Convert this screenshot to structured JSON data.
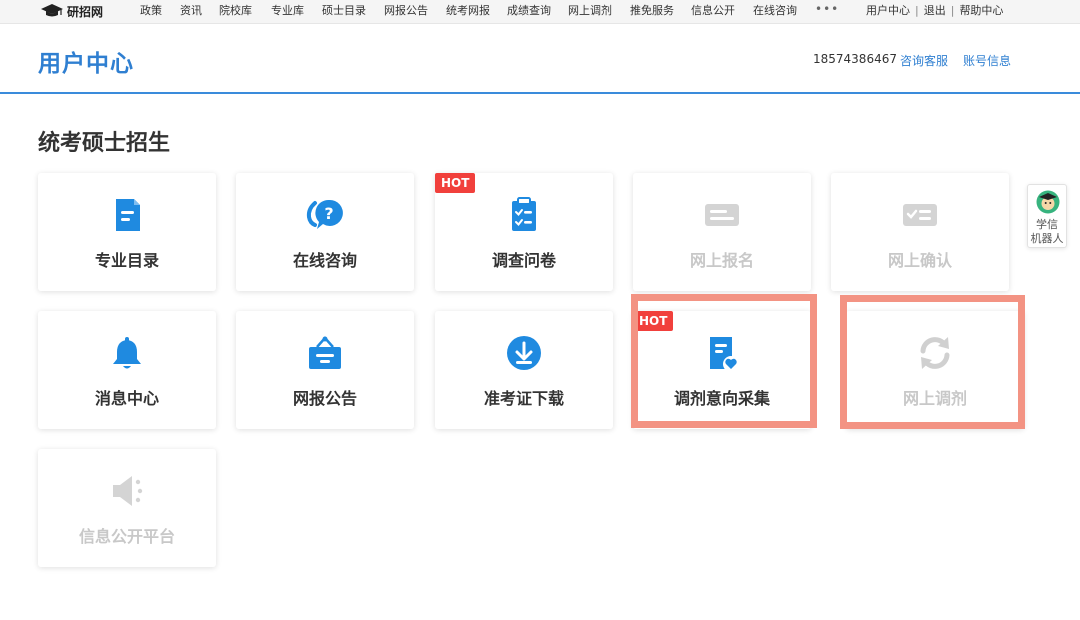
{
  "topnav": {
    "logo_text": "研招网",
    "items": [
      "政策",
      "资讯",
      "院校库",
      "专业库",
      "硕士目录",
      "网报公告",
      "统考网报",
      "成绩查询",
      "网上调剂",
      "推免服务",
      "信息公开",
      "在线咨询"
    ],
    "more": "•••",
    "right": [
      "用户中心",
      "退出",
      "帮助中心"
    ],
    "separator": "|"
  },
  "header": {
    "title": "用户中心",
    "phone": "18574386467",
    "links": [
      "咨询客服",
      "账号信息"
    ]
  },
  "section": {
    "title": "统考硕士招生"
  },
  "hot_label": "HOT",
  "cards": [
    {
      "label": "专业目录",
      "icon": "document-icon",
      "enabled": true,
      "hot": false
    },
    {
      "label": "在线咨询",
      "icon": "question-chat-icon",
      "enabled": true,
      "hot": false
    },
    {
      "label": "调查问卷",
      "icon": "clipboard-check-icon",
      "enabled": true,
      "hot": true
    },
    {
      "label": "网上报名",
      "icon": "card-icon",
      "enabled": false,
      "hot": false
    },
    {
      "label": "网上确认",
      "icon": "card-check-icon",
      "enabled": false,
      "hot": false
    },
    {
      "label": "消息中心",
      "icon": "bell-icon",
      "enabled": true,
      "hot": false
    },
    {
      "label": "网报公告",
      "icon": "notice-board-icon",
      "enabled": true,
      "hot": false
    },
    {
      "label": "准考证下载",
      "icon": "download-icon",
      "enabled": true,
      "hot": false
    },
    {
      "label": "调剂意向采集",
      "icon": "document-heart-icon",
      "enabled": true,
      "hot": true
    },
    {
      "label": "网上调剂",
      "icon": "refresh-icon",
      "enabled": false,
      "hot": false
    },
    {
      "label": "信息公开平台",
      "icon": "speaker-icon",
      "enabled": false,
      "hot": false
    }
  ],
  "robot": {
    "line1": "学信",
    "line2": "机器人"
  },
  "colors": {
    "accent": "#2f7fd1",
    "icon_blue": "#1f8ae0",
    "disabled": "#c8c8c8",
    "hot": "#f1403c",
    "highlight": "#f39383"
  }
}
